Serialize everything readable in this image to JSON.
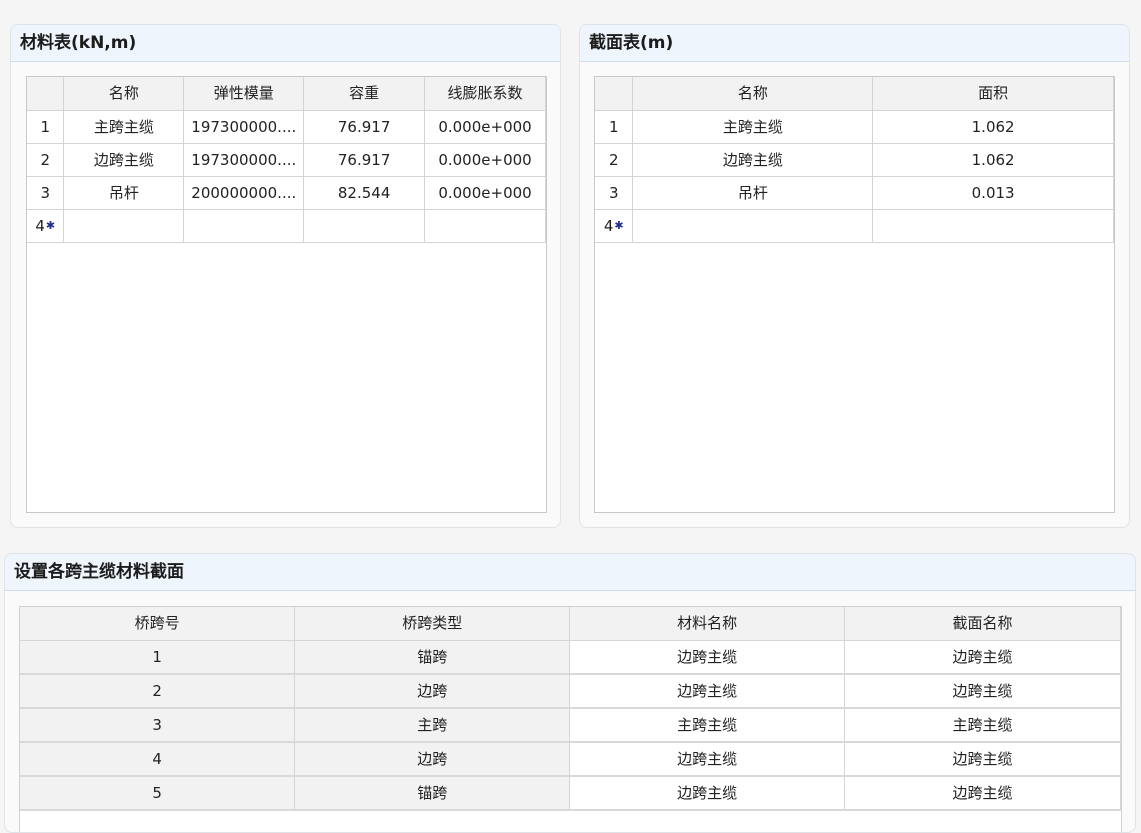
{
  "material_panel": {
    "title": "材料表(kN,m)",
    "columns": [
      "",
      "名称",
      "弹性模量",
      "容重",
      "线膨胀系数"
    ],
    "rows": [
      {
        "index": "1",
        "name": "主跨主缆",
        "modulus": "197300000....",
        "weight": "76.917",
        "expansion": "0.000e+000"
      },
      {
        "index": "2",
        "name": "边跨主缆",
        "modulus": "197300000....",
        "weight": "76.917",
        "expansion": "0.000e+000"
      },
      {
        "index": "3",
        "name": "吊杆",
        "modulus": "200000000....",
        "weight": "82.544",
        "expansion": "0.000e+000"
      }
    ],
    "new_row_index": "4"
  },
  "section_panel": {
    "title": "截面表(m)",
    "columns": [
      "",
      "名称",
      "面积"
    ],
    "rows": [
      {
        "index": "1",
        "name": "主跨主缆",
        "area": "1.062"
      },
      {
        "index": "2",
        "name": "边跨主缆",
        "area": "1.062"
      },
      {
        "index": "3",
        "name": "吊杆",
        "area": "0.013"
      }
    ],
    "new_row_index": "4"
  },
  "span_panel": {
    "title": "设置各跨主缆材料截面",
    "columns": [
      "桥跨号",
      "桥跨类型",
      "材料名称",
      "截面名称"
    ],
    "rows": [
      {
        "span_no": "1",
        "span_type": "锚跨",
        "material": "边跨主缆",
        "section": "边跨主缆"
      },
      {
        "span_no": "2",
        "span_type": "边跨",
        "material": "边跨主缆",
        "section": "边跨主缆"
      },
      {
        "span_no": "3",
        "span_type": "主跨",
        "material": "主跨主缆",
        "section": "主跨主缆"
      },
      {
        "span_no": "4",
        "span_type": "边跨",
        "material": "边跨主缆",
        "section": "边跨主缆"
      },
      {
        "span_no": "5",
        "span_type": "锚跨",
        "material": "边跨主缆",
        "section": "边跨主缆"
      }
    ]
  },
  "icons": {
    "new_row_marker": "asterisk-icon"
  }
}
